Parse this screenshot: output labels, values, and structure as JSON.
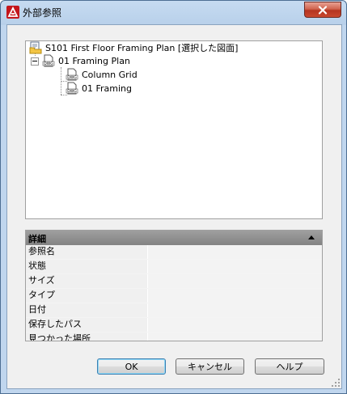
{
  "window": {
    "title": "外部参照"
  },
  "tree": {
    "root": "S101 First Floor Framing Plan [選択した図面]",
    "items": [
      {
        "label": "01 Framing Plan",
        "level": 1
      },
      {
        "label": "Column Grid",
        "level": 2
      },
      {
        "label": "01 Framing",
        "level": 2
      }
    ]
  },
  "details": {
    "header": "詳細",
    "properties": [
      "参照名",
      "状態",
      "サイズ",
      "タイプ",
      "日付",
      "保存したパス",
      "見つかった場所"
    ]
  },
  "buttons": {
    "ok": "OK",
    "cancel": "キャンセル",
    "help": "ヘルプ"
  },
  "colors": {
    "title_bar": "#b9d1ea",
    "close_button": "#c94a32",
    "details_header": "#8f8f8f"
  }
}
